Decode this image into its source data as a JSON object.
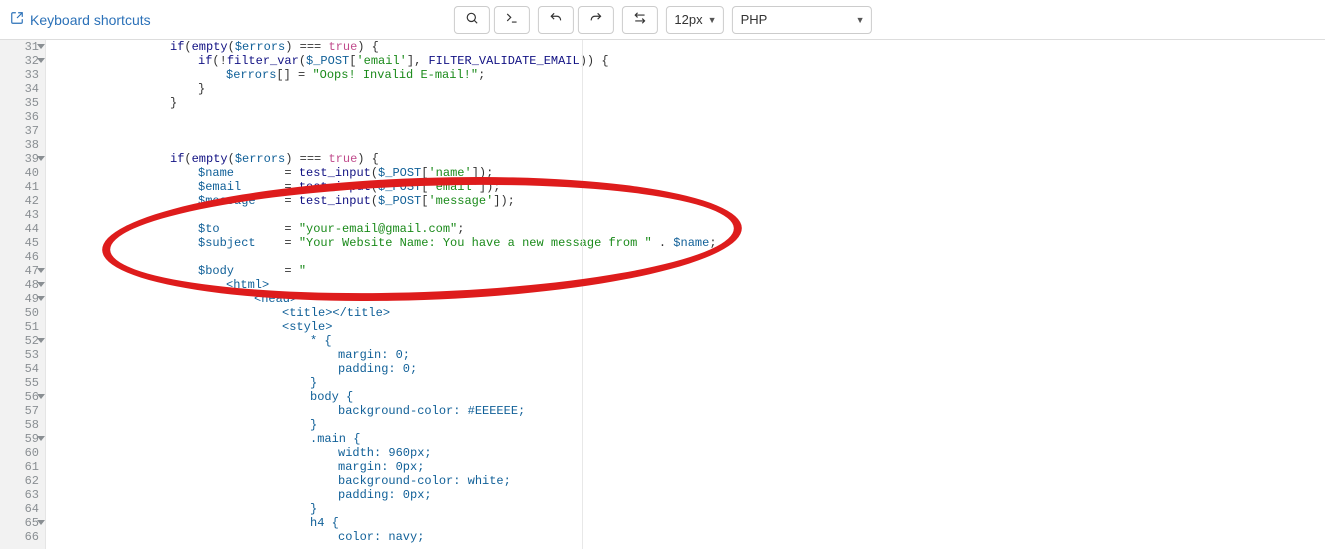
{
  "toolbar": {
    "keyboard_shortcuts": "Keyboard shortcuts",
    "font_size": "12px",
    "language": "PHP"
  },
  "gutter": {
    "start": 31,
    "end": 66,
    "fold_lines": [
      31,
      32,
      39,
      47,
      48,
      49,
      52,
      56,
      59,
      65
    ]
  },
  "code": {
    "lines": [
      {
        "indent": 8,
        "tokens": [
          [
            "kw",
            "if"
          ],
          [
            "punct",
            "("
          ],
          [
            "func",
            "empty"
          ],
          [
            "punct",
            "("
          ],
          [
            "var",
            "$errors"
          ],
          [
            "punct",
            ") "
          ],
          [
            "punct",
            "==="
          ],
          [
            "punct",
            " "
          ],
          [
            "bool",
            "true"
          ],
          [
            "punct",
            ") {"
          ]
        ]
      },
      {
        "indent": 12,
        "tokens": [
          [
            "kw",
            "if"
          ],
          [
            "punct",
            "("
          ],
          [
            "punct",
            "!"
          ],
          [
            "func",
            "filter_var"
          ],
          [
            "punct",
            "("
          ],
          [
            "var",
            "$_POST"
          ],
          [
            "punct",
            "["
          ],
          [
            "str",
            "'email'"
          ],
          [
            "punct",
            "], "
          ],
          [
            "const",
            "FILTER_VALIDATE_EMAIL"
          ],
          [
            "punct",
            ")) {"
          ]
        ]
      },
      {
        "indent": 16,
        "tokens": [
          [
            "var",
            "$errors"
          ],
          [
            "punct",
            "[] = "
          ],
          [
            "str",
            "\"Oops! Invalid E-mail!\""
          ],
          [
            "punct",
            ";"
          ]
        ]
      },
      {
        "indent": 12,
        "tokens": [
          [
            "punct",
            "}"
          ]
        ]
      },
      {
        "indent": 8,
        "tokens": [
          [
            "punct",
            "}"
          ]
        ]
      },
      {
        "indent": 0,
        "tokens": []
      },
      {
        "indent": 0,
        "tokens": []
      },
      {
        "indent": 0,
        "tokens": []
      },
      {
        "indent": 8,
        "tokens": [
          [
            "kw",
            "if"
          ],
          [
            "punct",
            "("
          ],
          [
            "func",
            "empty"
          ],
          [
            "punct",
            "("
          ],
          [
            "var",
            "$errors"
          ],
          [
            "punct",
            ") "
          ],
          [
            "punct",
            "==="
          ],
          [
            "punct",
            " "
          ],
          [
            "bool",
            "true"
          ],
          [
            "punct",
            ") {"
          ]
        ]
      },
      {
        "indent": 12,
        "tokens": [
          [
            "var",
            "$name"
          ],
          [
            "punct",
            "       = "
          ],
          [
            "func",
            "test_input"
          ],
          [
            "punct",
            "("
          ],
          [
            "var",
            "$_POST"
          ],
          [
            "punct",
            "["
          ],
          [
            "str",
            "'name'"
          ],
          [
            "punct",
            "]);"
          ]
        ]
      },
      {
        "indent": 12,
        "tokens": [
          [
            "var",
            "$email"
          ],
          [
            "punct",
            "      = "
          ],
          [
            "func",
            "test_input"
          ],
          [
            "punct",
            "("
          ],
          [
            "var",
            "$_POST"
          ],
          [
            "punct",
            "["
          ],
          [
            "str",
            "'email'"
          ],
          [
            "punct",
            "]);"
          ]
        ]
      },
      {
        "indent": 12,
        "tokens": [
          [
            "var",
            "$message"
          ],
          [
            "punct",
            "    = "
          ],
          [
            "func",
            "test_input"
          ],
          [
            "punct",
            "("
          ],
          [
            "var",
            "$_POST"
          ],
          [
            "punct",
            "["
          ],
          [
            "str",
            "'message'"
          ],
          [
            "punct",
            "]);"
          ]
        ]
      },
      {
        "indent": 0,
        "tokens": []
      },
      {
        "indent": 12,
        "tokens": [
          [
            "var",
            "$to"
          ],
          [
            "punct",
            "         = "
          ],
          [
            "str",
            "\"your-email@gmail.com\""
          ],
          [
            "punct",
            ";"
          ]
        ]
      },
      {
        "indent": 12,
        "tokens": [
          [
            "var",
            "$subject"
          ],
          [
            "punct",
            "    = "
          ],
          [
            "str",
            "\"Your Website Name: You have a new message from \""
          ],
          [
            "punct",
            " . "
          ],
          [
            "var",
            "$name"
          ],
          [
            "punct",
            ";"
          ]
        ]
      },
      {
        "indent": 0,
        "tokens": []
      },
      {
        "indent": 12,
        "tokens": [
          [
            "var",
            "$body"
          ],
          [
            "punct",
            "       = "
          ],
          [
            "str",
            "\""
          ]
        ]
      },
      {
        "indent": 16,
        "tokens": [
          [
            "tag",
            "<html>"
          ]
        ]
      },
      {
        "indent": 20,
        "tokens": [
          [
            "tag",
            "<head>"
          ]
        ]
      },
      {
        "indent": 24,
        "tokens": [
          [
            "tag",
            "<title></title>"
          ]
        ]
      },
      {
        "indent": 24,
        "tokens": [
          [
            "tag",
            "<style>"
          ]
        ]
      },
      {
        "indent": 28,
        "tokens": [
          [
            "tag",
            "* {"
          ]
        ]
      },
      {
        "indent": 32,
        "tokens": [
          [
            "tag",
            "margin: 0;"
          ]
        ]
      },
      {
        "indent": 32,
        "tokens": [
          [
            "tag",
            "padding: 0;"
          ]
        ]
      },
      {
        "indent": 28,
        "tokens": [
          [
            "tag",
            "}"
          ]
        ]
      },
      {
        "indent": 28,
        "tokens": [
          [
            "tag",
            "body {"
          ]
        ]
      },
      {
        "indent": 32,
        "tokens": [
          [
            "tag",
            "background-color: #EEEEEE;"
          ]
        ]
      },
      {
        "indent": 28,
        "tokens": [
          [
            "tag",
            "}"
          ]
        ]
      },
      {
        "indent": 28,
        "tokens": [
          [
            "tag",
            ".main {"
          ]
        ]
      },
      {
        "indent": 32,
        "tokens": [
          [
            "tag",
            "width: 960px;"
          ]
        ]
      },
      {
        "indent": 32,
        "tokens": [
          [
            "tag",
            "margin: 0px;"
          ]
        ]
      },
      {
        "indent": 32,
        "tokens": [
          [
            "tag",
            "background-color: white;"
          ]
        ]
      },
      {
        "indent": 32,
        "tokens": [
          [
            "tag",
            "padding: 0px;"
          ]
        ]
      },
      {
        "indent": 28,
        "tokens": [
          [
            "tag",
            "}"
          ]
        ]
      },
      {
        "indent": 28,
        "tokens": [
          [
            "tag",
            "h4 {"
          ]
        ]
      },
      {
        "indent": 32,
        "tokens": [
          [
            "tag",
            "color: navy;"
          ]
        ]
      }
    ]
  }
}
